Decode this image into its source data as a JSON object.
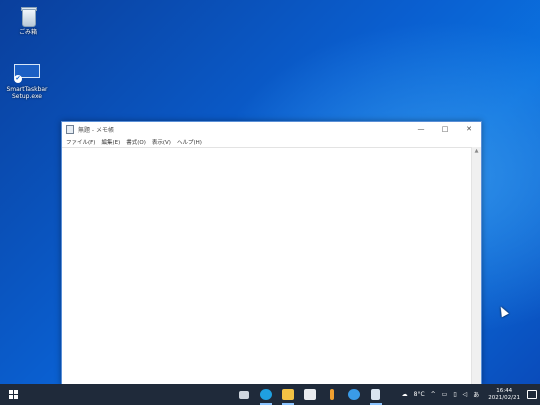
{
  "desktop": {
    "icons": [
      {
        "label": "ごみ箱",
        "icon": "recycle-bin-icon"
      },
      {
        "label": "SmartTaskbar Setup.exe",
        "icon": "monitor-setup-icon"
      }
    ]
  },
  "notepad": {
    "title": "無題 - メモ帳",
    "menu": [
      "ファイル(F)",
      "編集(E)",
      "書式(O)",
      "表示(V)",
      "ヘルプ(H)"
    ],
    "controls": {
      "minimize": "—",
      "maximize": "□",
      "close": "✕"
    },
    "scroll_up": "▲"
  },
  "taskbar": {
    "weather_temp": "8°C",
    "ime": "あ",
    "time": "16:44",
    "date": "2021/02/21",
    "tray_up": "^",
    "apps": [
      {
        "name": "task-view-icon",
        "color": "#cfd6df"
      },
      {
        "name": "edge-icon",
        "color": "#1fa0e0"
      },
      {
        "name": "file-explorer-icon",
        "color": "#f3c244"
      },
      {
        "name": "store-icon",
        "color": "#e9ecef"
      },
      {
        "name": "pen-app-icon",
        "color": "#f0a030"
      },
      {
        "name": "ie-icon",
        "color": "#3a9be8"
      },
      {
        "name": "notepad-icon",
        "color": "#d8e4f0"
      }
    ]
  }
}
